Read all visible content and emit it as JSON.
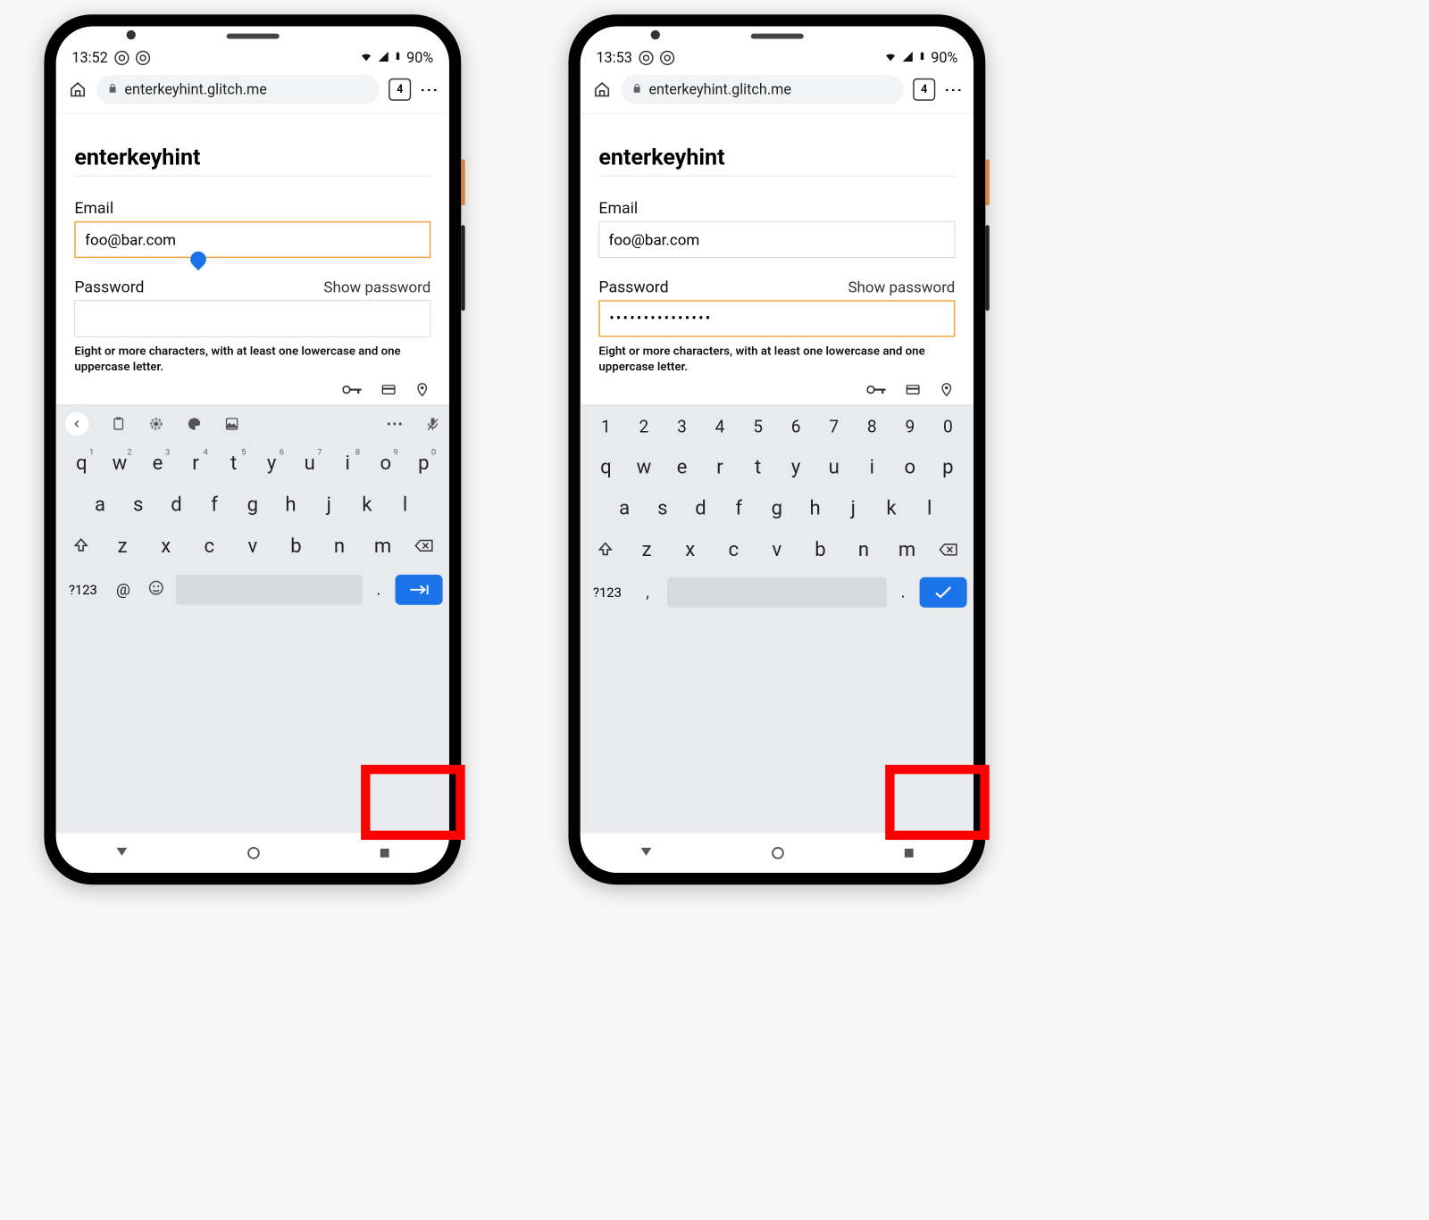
{
  "phones": [
    "left",
    "right"
  ],
  "left": {
    "status": {
      "time": "13:52",
      "battery": "90%"
    },
    "omnibox": {
      "url": "enterkeyhint.glitch.me",
      "tabs": "4"
    },
    "page": {
      "title": "enterkeyhint",
      "email_label": "Email",
      "email_value": "foo@bar.com",
      "password_label": "Password",
      "show_password": "Show password",
      "password_value": "",
      "hint": "Eight or more characters, with at least\none lowercase and one uppercase letter."
    },
    "focus": "email",
    "keyboard": {
      "has_number_row": false,
      "has_toolbar": true,
      "row1": [
        {
          "k": "q",
          "n": "1"
        },
        {
          "k": "w",
          "n": "2"
        },
        {
          "k": "e",
          "n": "3"
        },
        {
          "k": "r",
          "n": "4"
        },
        {
          "k": "t",
          "n": "5"
        },
        {
          "k": "y",
          "n": "6"
        },
        {
          "k": "u",
          "n": "7"
        },
        {
          "k": "i",
          "n": "8"
        },
        {
          "k": "o",
          "n": "9"
        },
        {
          "k": "p",
          "n": "0"
        }
      ],
      "row2": [
        "a",
        "s",
        "d",
        "f",
        "g",
        "h",
        "j",
        "k",
        "l"
      ],
      "row3": [
        "z",
        "x",
        "c",
        "v",
        "b",
        "n",
        "m"
      ],
      "sym": "?123",
      "extra1": "@",
      "period": ".",
      "enter": "next"
    }
  },
  "right": {
    "status": {
      "time": "13:53",
      "battery": "90%"
    },
    "omnibox": {
      "url": "enterkeyhint.glitch.me",
      "tabs": "4"
    },
    "page": {
      "title": "enterkeyhint",
      "email_label": "Email",
      "email_value": "foo@bar.com",
      "password_label": "Password",
      "show_password": "Show password",
      "password_value": "•••••••••••••••",
      "hint": "Eight or more characters, with at least\none lowercase and one uppercase letter."
    },
    "focus": "password",
    "keyboard": {
      "has_number_row": true,
      "has_toolbar": false,
      "nums": [
        "1",
        "2",
        "3",
        "4",
        "5",
        "6",
        "7",
        "8",
        "9",
        "0"
      ],
      "row1": [
        {
          "k": "q"
        },
        {
          "k": "w"
        },
        {
          "k": "e"
        },
        {
          "k": "r"
        },
        {
          "k": "t"
        },
        {
          "k": "y"
        },
        {
          "k": "u"
        },
        {
          "k": "i"
        },
        {
          "k": "o"
        },
        {
          "k": "p"
        }
      ],
      "row2": [
        "a",
        "s",
        "d",
        "f",
        "g",
        "h",
        "j",
        "k",
        "l"
      ],
      "row3": [
        "z",
        "x",
        "c",
        "v",
        "b",
        "n",
        "m"
      ],
      "sym": "?123",
      "extra1": ",",
      "period": ".",
      "enter": "done"
    }
  }
}
